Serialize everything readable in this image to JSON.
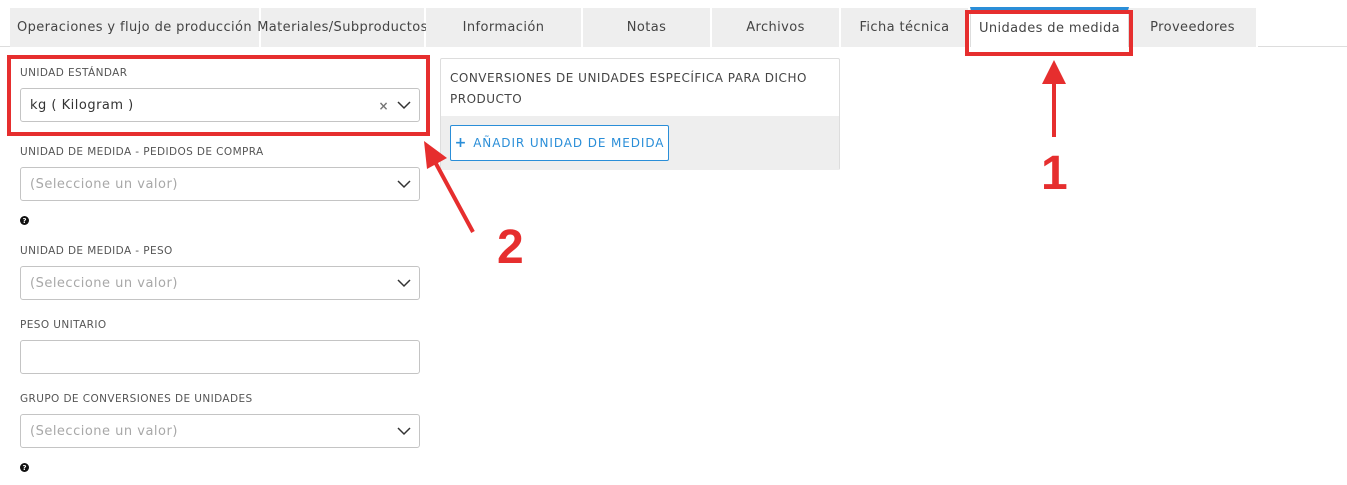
{
  "tabs": [
    {
      "label": "Operaciones y flujo de producción",
      "active": false
    },
    {
      "label": "Materiales/Subproductos",
      "active": false
    },
    {
      "label": "Información",
      "active": false
    },
    {
      "label": "Notas",
      "active": false
    },
    {
      "label": "Archivos",
      "active": false
    },
    {
      "label": "Ficha técnica",
      "active": false
    },
    {
      "label": "Unidades de medida",
      "active": true
    },
    {
      "label": "Proveedores",
      "active": false
    }
  ],
  "form": {
    "standard_unit": {
      "label": "UNIDAD ESTÁNDAR",
      "value": "kg ( Kilogram )"
    },
    "purchase_unit": {
      "label": "UNIDAD DE MEDIDA - PEDIDOS DE COMPRA",
      "placeholder": "(Seleccione un valor)"
    },
    "weight_unit": {
      "label": "UNIDAD DE MEDIDA - PESO",
      "placeholder": "(Seleccione un valor)"
    },
    "unit_weight": {
      "label": "PESO UNITARIO",
      "value": ""
    },
    "conversion_group": {
      "label": "GRUPO DE CONVERSIONES DE UNIDADES",
      "placeholder": "(Seleccione un valor)"
    },
    "help_glyph": "?"
  },
  "conversions_panel": {
    "title": "CONVERSIONES DE UNIDADES ESPECÍFICA PARA DICHO PRODUCTO",
    "add_button": "AÑADIR UNIDAD DE MEDIDA",
    "add_icon": "+"
  },
  "annotations": {
    "step1": "1",
    "step2": "2",
    "color": "#e62e2e"
  },
  "colors": {
    "accent": "#2a8ed8",
    "tab_bg": "#eeeeee"
  }
}
